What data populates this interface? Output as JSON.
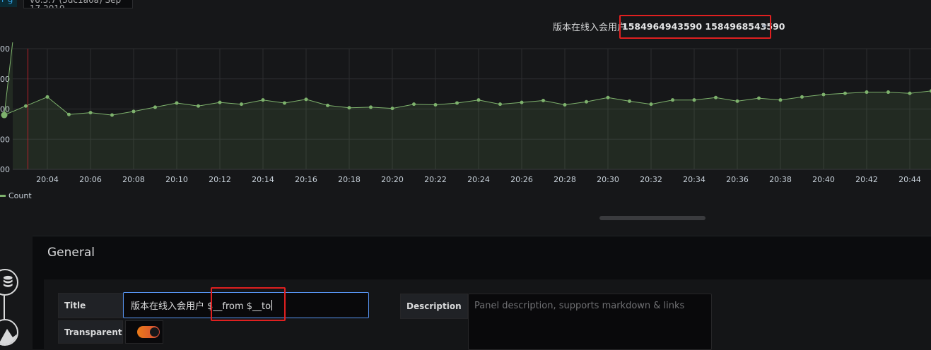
{
  "top": {
    "version_text": "v6.3.7 (3dc1a6a) Sep 17 2019",
    "edge_text": "r g"
  },
  "panel": {
    "title_prefix": "版本在线入会用户",
    "title_vars": "1584964943590 1584968543590",
    "dropdown_icon": "caret-down-icon"
  },
  "chart_data": {
    "type": "area",
    "series": [
      {
        "name": "Count",
        "color": "#7eb26d",
        "x": [
          "20:02",
          "20:03",
          "20:04",
          "20:05",
          "20:06",
          "20:07",
          "20:08",
          "20:09",
          "20:10",
          "20:11",
          "20:12",
          "20:13",
          "20:14",
          "20:15",
          "20:16",
          "20:17",
          "20:18",
          "20:19",
          "20:20",
          "20:21",
          "20:22",
          "20:23",
          "20:24",
          "20:25",
          "20:26",
          "20:27",
          "20:28",
          "20:29",
          "20:30",
          "20:31",
          "20:32",
          "20:33",
          "20:34",
          "20:35",
          "20:36",
          "20:37",
          "20:38",
          "20:39",
          "20:40",
          "20:41",
          "20:42",
          "20:43",
          "20:44",
          "20:45"
        ],
        "values": [
          790,
          805,
          820,
          791,
          794,
          790,
          796,
          803,
          810,
          805,
          811,
          808,
          815,
          810,
          816,
          806,
          802,
          803,
          801,
          808,
          807,
          810,
          815,
          808,
          811,
          814,
          807,
          812,
          819,
          813,
          808,
          815,
          815,
          819,
          813,
          818,
          815,
          820,
          824,
          826,
          828,
          828,
          826,
          830
        ]
      }
    ],
    "x_ticks": [
      "20:04",
      "20:06",
      "20:08",
      "20:10",
      "20:12",
      "20:14",
      "20:16",
      "20:18",
      "20:20",
      "20:22",
      "20:24",
      "20:26",
      "20:28",
      "20:30",
      "20:32",
      "20:34",
      "20:36",
      "20:38",
      "20:40",
      "20:42",
      "20:44"
    ],
    "y_ticks": [
      "00",
      "00",
      "00",
      "00",
      "00"
    ],
    "ylim": [
      900,
      700
    ],
    "annotation_color": "#b7202b",
    "grid": true,
    "legend": "bottom-left"
  },
  "legend": {
    "label": "Count"
  },
  "editor": {
    "section_title": "General",
    "title_label": "Title",
    "title_value": "版本在线入会用户 $__from $__to",
    "transparent_label": "Transparent",
    "transparent_on": true,
    "description_label": "Description",
    "description_placeholder": "Panel description, supports markdown & links"
  },
  "side_icons": [
    "database-icon",
    "chart-area-icon"
  ],
  "colors": {
    "accent_orange": "#eb7b18",
    "highlight_red": "#e02020",
    "focus_blue": "#5794f2"
  }
}
